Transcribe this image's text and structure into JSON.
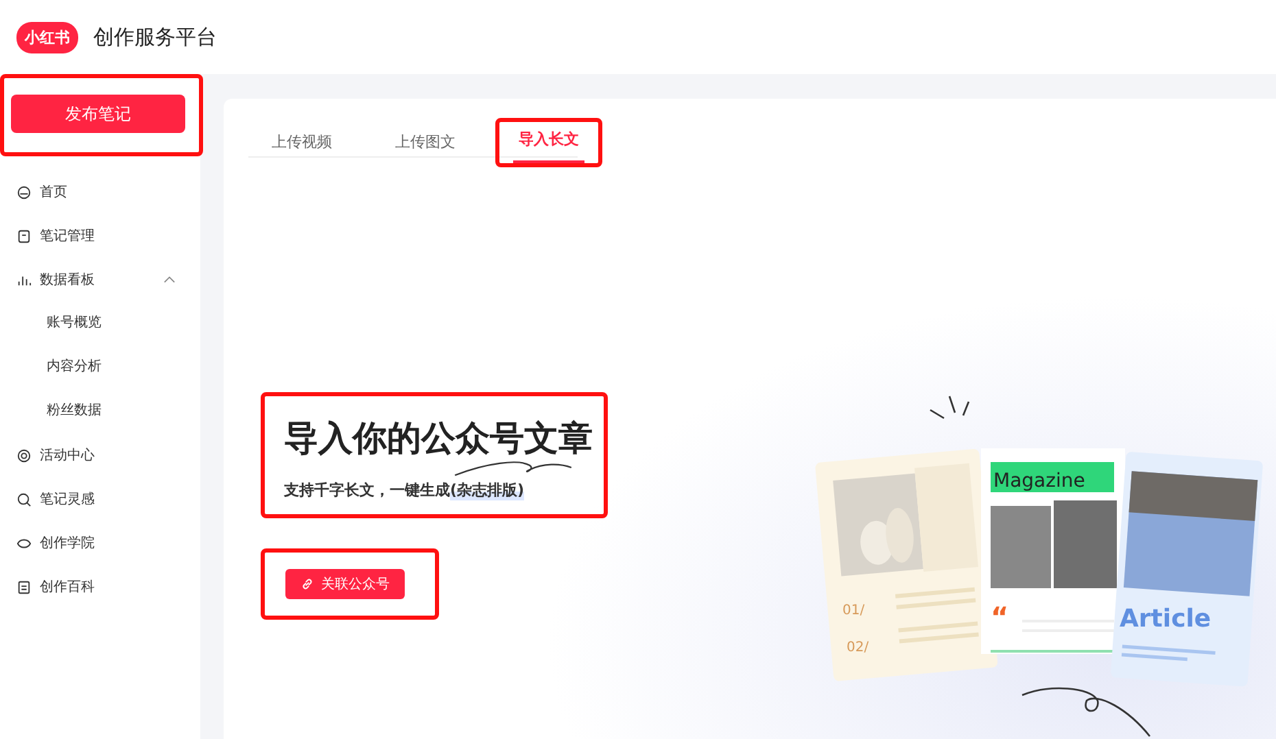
{
  "header": {
    "logo": "小红书",
    "title": "创作服务平台"
  },
  "sidebar": {
    "publish_button": {
      "label": "发布笔记",
      "highlighted": true
    },
    "items": [
      {
        "label": "首页"
      },
      {
        "label": "笔记管理"
      },
      {
        "label": "数据看板",
        "expanded": true,
        "children": [
          {
            "label": "账号概览"
          },
          {
            "label": "内容分析"
          },
          {
            "label": "粉丝数据"
          }
        ]
      },
      {
        "label": "活动中心"
      },
      {
        "label": "笔记灵感"
      },
      {
        "label": "创作学院"
      },
      {
        "label": "创作百科"
      }
    ]
  },
  "tabs": [
    {
      "label": "上传视频",
      "selected": false,
      "highlighted": false
    },
    {
      "label": "上传图文",
      "selected": false,
      "highlighted": false
    },
    {
      "label": "导入长文",
      "selected": true,
      "highlighted": true
    }
  ],
  "hero": {
    "title": "导入你的公众号文章",
    "subtitle": "支持千字长文，一键生成",
    "subtitle_tag": "(杂志排版)",
    "highlighted": true
  },
  "link_button": {
    "label": "关联公众号",
    "highlighted": true
  },
  "illustration": {
    "numbers": [
      "01/",
      "02/"
    ],
    "quote_mark": "“",
    "magazine_label": "Magazine",
    "article_label": "Article"
  }
}
